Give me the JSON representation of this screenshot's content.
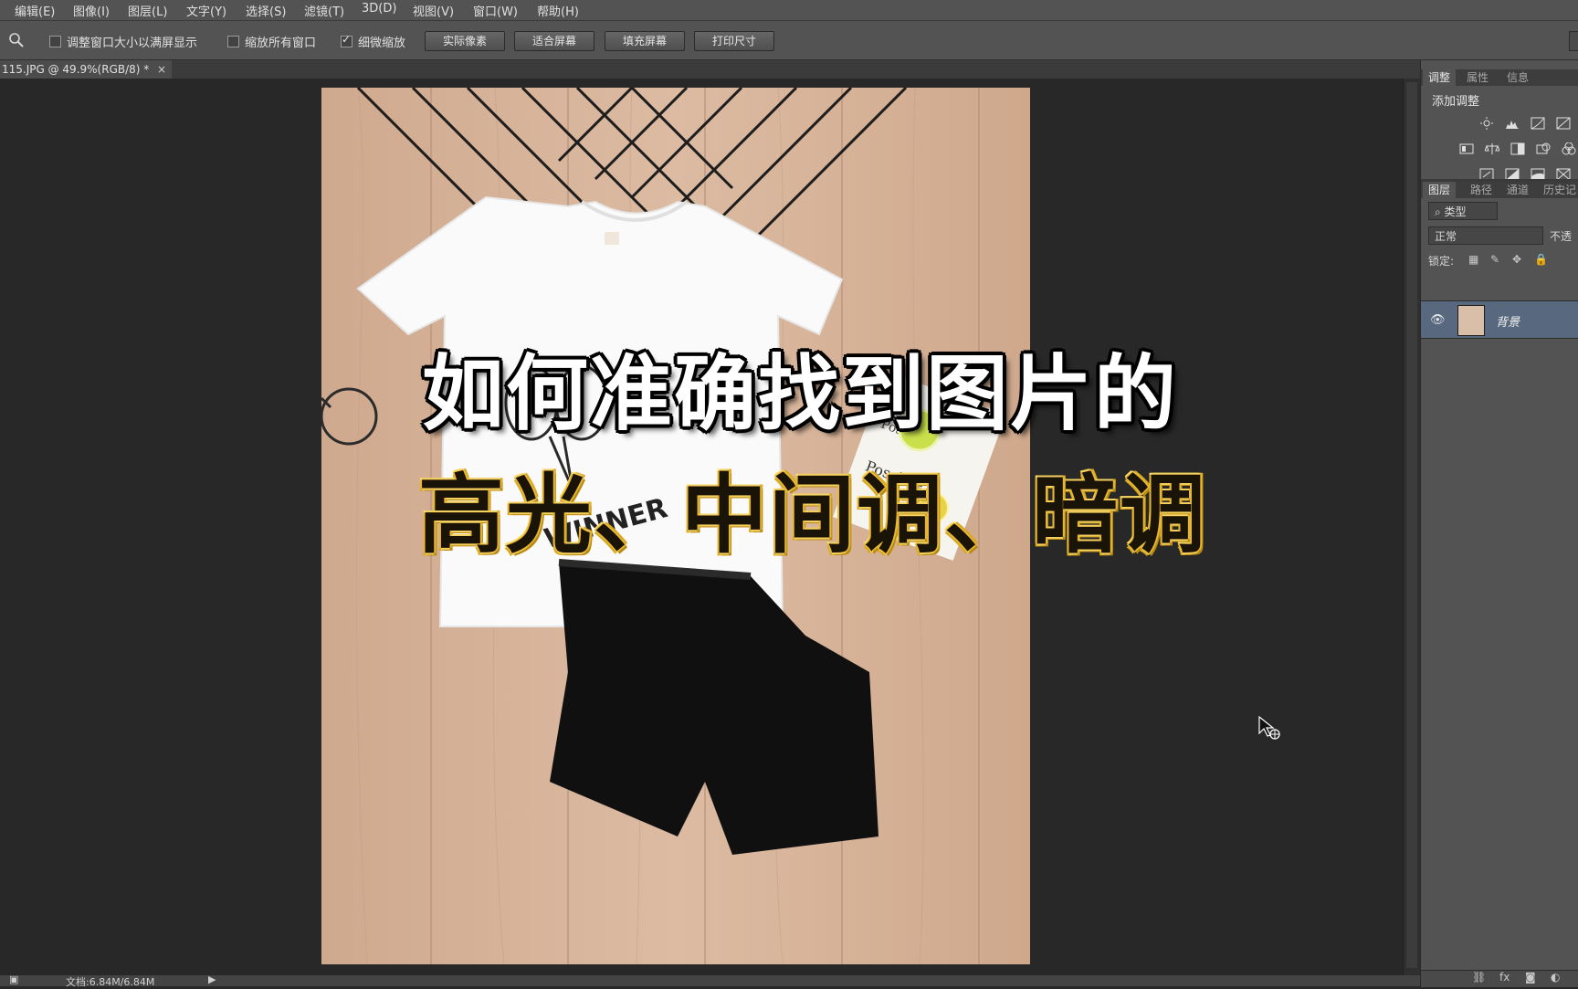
{
  "menu": {
    "items": [
      "编辑(E)",
      "图像(I)",
      "图层(L)",
      "文字(Y)",
      "选择(S)",
      "滤镜(T)",
      "3D(D)",
      "视图(V)",
      "窗口(W)",
      "帮助(H)"
    ]
  },
  "options": {
    "zoom_icon": "zoom-icon",
    "check_resize": "调整窗口大小以满屏显示",
    "check_zoom_all": "缩放所有窗口",
    "check_scrubby": "细微缩放",
    "btn_actual": "实际像素",
    "btn_fit": "适合屏幕",
    "btn_fill": "填充屏幕",
    "btn_print": "打印尺寸"
  },
  "document": {
    "tab_label": "115.JPG @ 49.9%(RGB/8) *",
    "close": "×"
  },
  "overlay": {
    "line1": "如何准确找到图片的",
    "line2": "高光、中间调、暗调"
  },
  "status": {
    "doc_info": "文档:6.84M/6.84M"
  },
  "panel": {
    "tabs_top": [
      "调整",
      "属性",
      "信息"
    ],
    "add_adjustment": "添加调整",
    "tabs_layers": [
      "图层",
      "路径",
      "通道",
      "历史记"
    ],
    "filter_kind": "类型",
    "blend_mode": "正常",
    "opacity_label": "不透",
    "lock_label": "锁定:",
    "layer_name": "背景"
  },
  "colors": {
    "accent_selected_layer": "#58687e",
    "title2_gold": "#e8b830"
  }
}
